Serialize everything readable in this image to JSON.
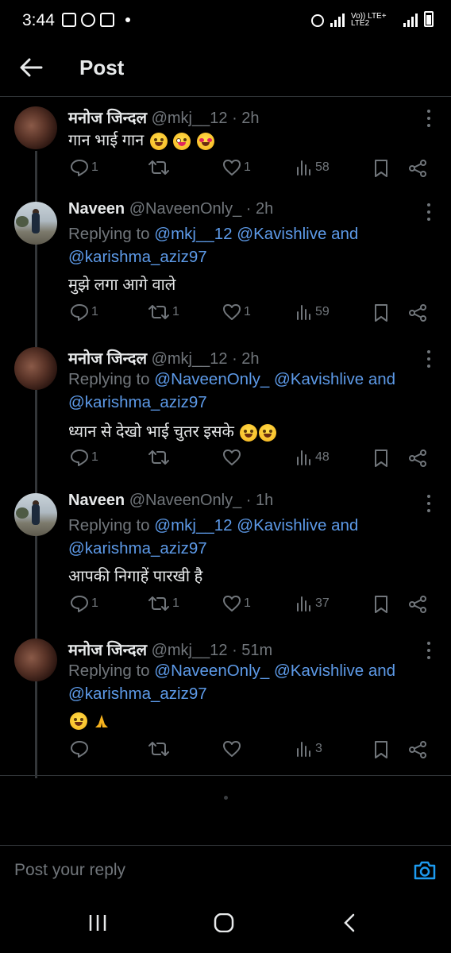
{
  "status_bar": {
    "time": "3:44",
    "network_label": "Vo)) LTE+ LTE2"
  },
  "header": {
    "title": "Post",
    "back_icon": "back-arrow-icon"
  },
  "posts": [
    {
      "name": "मनोज जिन्दल",
      "handle": "@mkj__12",
      "time": "· 2h",
      "replying_prefix": "",
      "mentions": [],
      "and_text": "",
      "mention2": "",
      "text": "गान भाई गान",
      "emojis": [
        "rofl",
        "zany",
        "heart-eyes"
      ],
      "replies": "1",
      "reposts": "",
      "likes": "1",
      "views": "58"
    },
    {
      "name": "Naveen",
      "handle": "@NaveenOnly_",
      "time": "· 2h",
      "replying_prefix": "Replying to",
      "mentions": [
        "@mkj__12",
        "@Kavishlive"
      ],
      "and_text": "and",
      "mention2": "@karishma_aziz97",
      "text": "मुझे लगा आगे वाले",
      "emojis": [],
      "replies": "1",
      "reposts": "1",
      "likes": "1",
      "views": "59"
    },
    {
      "name": "मनोज जिन्दल",
      "handle": "@mkj__12",
      "time": "· 2h",
      "replying_prefix": "Replying to",
      "mentions": [
        "@NaveenOnly_",
        "@Kavishlive"
      ],
      "and_text": "and",
      "mention2": "@karishma_aziz97",
      "text": "ध्यान से देखो भाई चुतर इसके",
      "emojis": [
        "rofl",
        "rofl"
      ],
      "replies": "1",
      "reposts": "",
      "likes": "",
      "views": "48"
    },
    {
      "name": "Naveen",
      "handle": "@NaveenOnly_",
      "time": "· 1h",
      "replying_prefix": "Replying to",
      "mentions": [
        "@mkj__12",
        "@Kavishlive"
      ],
      "and_text": "and",
      "mention2": "@karishma_aziz97",
      "text": "आपकी निगाहें पारखी है",
      "emojis": [],
      "replies": "1",
      "reposts": "1",
      "likes": "1",
      "views": "37"
    },
    {
      "name": "मनोज जिन्दल",
      "handle": "@mkj__12",
      "time": "· 51m",
      "replying_prefix": "Replying to",
      "mentions": [
        "@NaveenOnly_",
        "@Kavishlive"
      ],
      "and_text": "and",
      "mention2": "@karishma_aziz97",
      "text": "",
      "emojis": [
        "rofl",
        "pray"
      ],
      "replies": "",
      "reposts": "",
      "likes": "",
      "views": "3"
    }
  ],
  "reply_bar": {
    "placeholder": "Post your reply",
    "camera_icon": "camera-icon"
  },
  "colors": {
    "background": "#000000",
    "text": "#e7e9ea",
    "muted": "#71767b",
    "link": "#5d9ae8",
    "divider": "#2f3336"
  }
}
